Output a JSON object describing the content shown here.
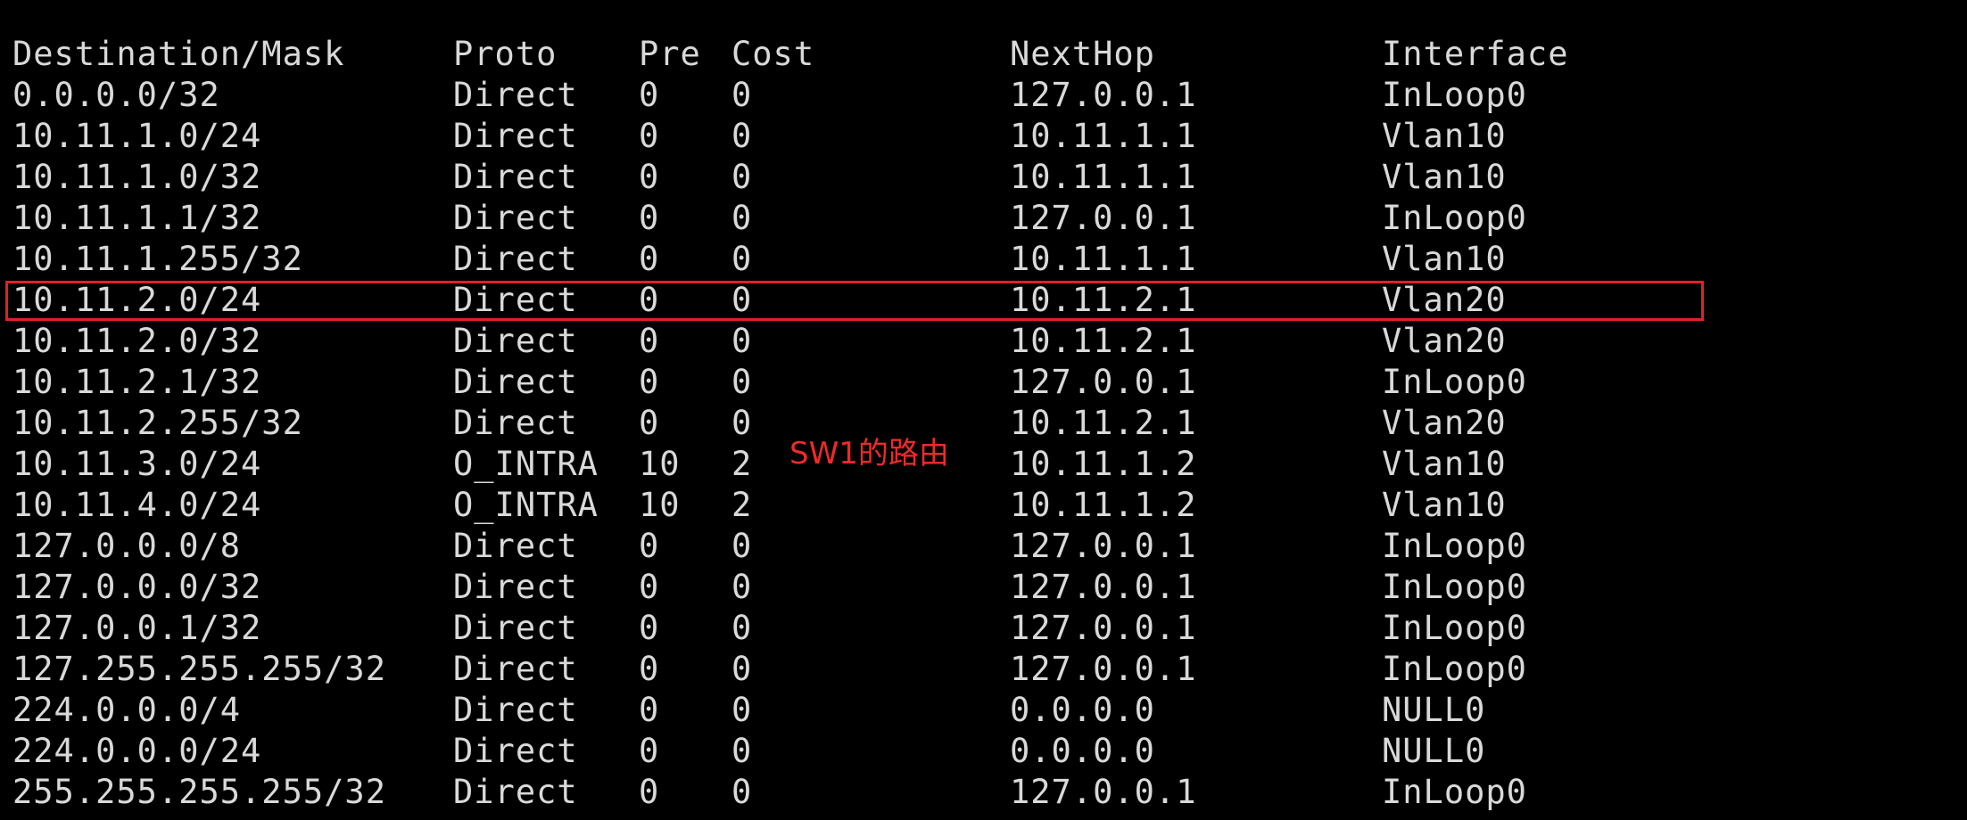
{
  "terminal": {
    "background": "#000000",
    "text_color": "#d9d9d9",
    "header": {
      "destination": "Destination/Mask",
      "proto": "Proto",
      "pre": "Pre",
      "cost": "Cost",
      "nexthop": "NextHop",
      "interface": "Interface"
    },
    "routes": [
      {
        "destination": "0.0.0.0/32",
        "proto": "Direct",
        "pre": "0",
        "cost": "0",
        "nexthop": "127.0.0.1",
        "interface": "InLoop0"
      },
      {
        "destination": "10.11.1.0/24",
        "proto": "Direct",
        "pre": "0",
        "cost": "0",
        "nexthop": "10.11.1.1",
        "interface": "Vlan10"
      },
      {
        "destination": "10.11.1.0/32",
        "proto": "Direct",
        "pre": "0",
        "cost": "0",
        "nexthop": "10.11.1.1",
        "interface": "Vlan10"
      },
      {
        "destination": "10.11.1.1/32",
        "proto": "Direct",
        "pre": "0",
        "cost": "0",
        "nexthop": "127.0.0.1",
        "interface": "InLoop0"
      },
      {
        "destination": "10.11.1.255/32",
        "proto": "Direct",
        "pre": "0",
        "cost": "0",
        "nexthop": "10.11.1.1",
        "interface": "Vlan10"
      },
      {
        "destination": "10.11.2.0/24",
        "proto": "Direct",
        "pre": "0",
        "cost": "0",
        "nexthop": "10.11.2.1",
        "interface": "Vlan20"
      },
      {
        "destination": "10.11.2.0/32",
        "proto": "Direct",
        "pre": "0",
        "cost": "0",
        "nexthop": "10.11.2.1",
        "interface": "Vlan20"
      },
      {
        "destination": "10.11.2.1/32",
        "proto": "Direct",
        "pre": "0",
        "cost": "0",
        "nexthop": "127.0.0.1",
        "interface": "InLoop0"
      },
      {
        "destination": "10.11.2.255/32",
        "proto": "Direct",
        "pre": "0",
        "cost": "0",
        "nexthop": "10.11.2.1",
        "interface": "Vlan20"
      },
      {
        "destination": "10.11.3.0/24",
        "proto": "O_INTRA",
        "pre": "10",
        "cost": "2",
        "nexthop": "10.11.1.2",
        "interface": "Vlan10"
      },
      {
        "destination": "10.11.4.0/24",
        "proto": "O_INTRA",
        "pre": "10",
        "cost": "2",
        "nexthop": "10.11.1.2",
        "interface": "Vlan10"
      },
      {
        "destination": "127.0.0.0/8",
        "proto": "Direct",
        "pre": "0",
        "cost": "0",
        "nexthop": "127.0.0.1",
        "interface": "InLoop0"
      },
      {
        "destination": "127.0.0.0/32",
        "proto": "Direct",
        "pre": "0",
        "cost": "0",
        "nexthop": "127.0.0.1",
        "interface": "InLoop0"
      },
      {
        "destination": "127.0.0.1/32",
        "proto": "Direct",
        "pre": "0",
        "cost": "0",
        "nexthop": "127.0.0.1",
        "interface": "InLoop0"
      },
      {
        "destination": "127.255.255.255/32",
        "proto": "Direct",
        "pre": "0",
        "cost": "0",
        "nexthop": "127.0.0.1",
        "interface": "InLoop0"
      },
      {
        "destination": "224.0.0.0/4",
        "proto": "Direct",
        "pre": "0",
        "cost": "0",
        "nexthop": "0.0.0.0",
        "interface": "NULL0"
      },
      {
        "destination": "224.0.0.0/24",
        "proto": "Direct",
        "pre": "0",
        "cost": "0",
        "nexthop": "0.0.0.0",
        "interface": "NULL0"
      },
      {
        "destination": "255.255.255.255/32",
        "proto": "Direct",
        "pre": "0",
        "cost": "0",
        "nexthop": "127.0.0.1",
        "interface": "InLoop0"
      }
    ]
  },
  "annotation": {
    "text": "SW1的路由",
    "color": "#ee2a2a"
  },
  "highlight": {
    "color": "#e0202a",
    "highlighted_destination": "10.11.2.0/24"
  }
}
